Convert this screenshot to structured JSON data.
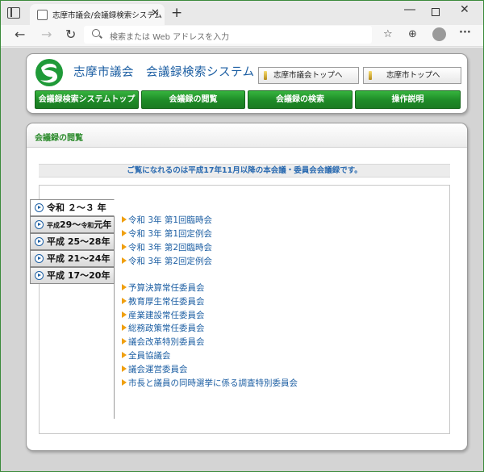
{
  "browser": {
    "tab_title": "志摩市議会/会議録検索システム",
    "tab_close": "✕",
    "new_tab": "+",
    "address_placeholder": "検索または Web アドレスを入力"
  },
  "header": {
    "site_title": "志摩市議会　会議録検索システム",
    "top_links": [
      "志摩市議会トップへ",
      "志摩市トップへ"
    ],
    "nav": [
      "会議録検索システムトップ",
      "会議録の閲覧",
      "会議録の検索",
      "操作説明"
    ]
  },
  "section": {
    "title": "会議録の閲覧",
    "notice": "ご覧になれるのは平成17年11月以降の本会議・委員会会議録です。"
  },
  "year_tabs": [
    {
      "era": "令和",
      "label": "２～３ 年",
      "small": false,
      "active": true
    },
    {
      "era": "平成",
      "label": "29～令和元年",
      "small": true,
      "active": false
    },
    {
      "era": "平成",
      "label": "25～28年",
      "small": false,
      "active": false
    },
    {
      "era": "平成",
      "label": "21～24年",
      "small": false,
      "active": false
    },
    {
      "era": "平成",
      "label": "17～20年",
      "small": false,
      "active": false
    }
  ],
  "year_tab_labels": [
    "令和 ２～３ 年",
    "平成29～令和元年",
    "平成 25～28年",
    "平成 21～24年",
    "平成 17～20年"
  ],
  "plenary_sessions": [
    "令和 3年 第1回臨時会",
    "令和 3年 第1回定例会",
    "令和 3年 第2回臨時会",
    "令和 3年 第2回定例会"
  ],
  "committees": [
    "予算決算常任委員会",
    "教育厚生常任委員会",
    "産業建設常任委員会",
    "総務政策常任委員会",
    "議会改革特別委員会",
    "全員協議会",
    "議会運営委員会",
    "市長と議員の同時選挙に係る調査特別委員会"
  ],
  "colors": {
    "nav_green": "#1e8a27",
    "link_blue": "#1d5fa3",
    "section_green": "#2a8a2a",
    "bullet_orange": "#f0a010"
  }
}
